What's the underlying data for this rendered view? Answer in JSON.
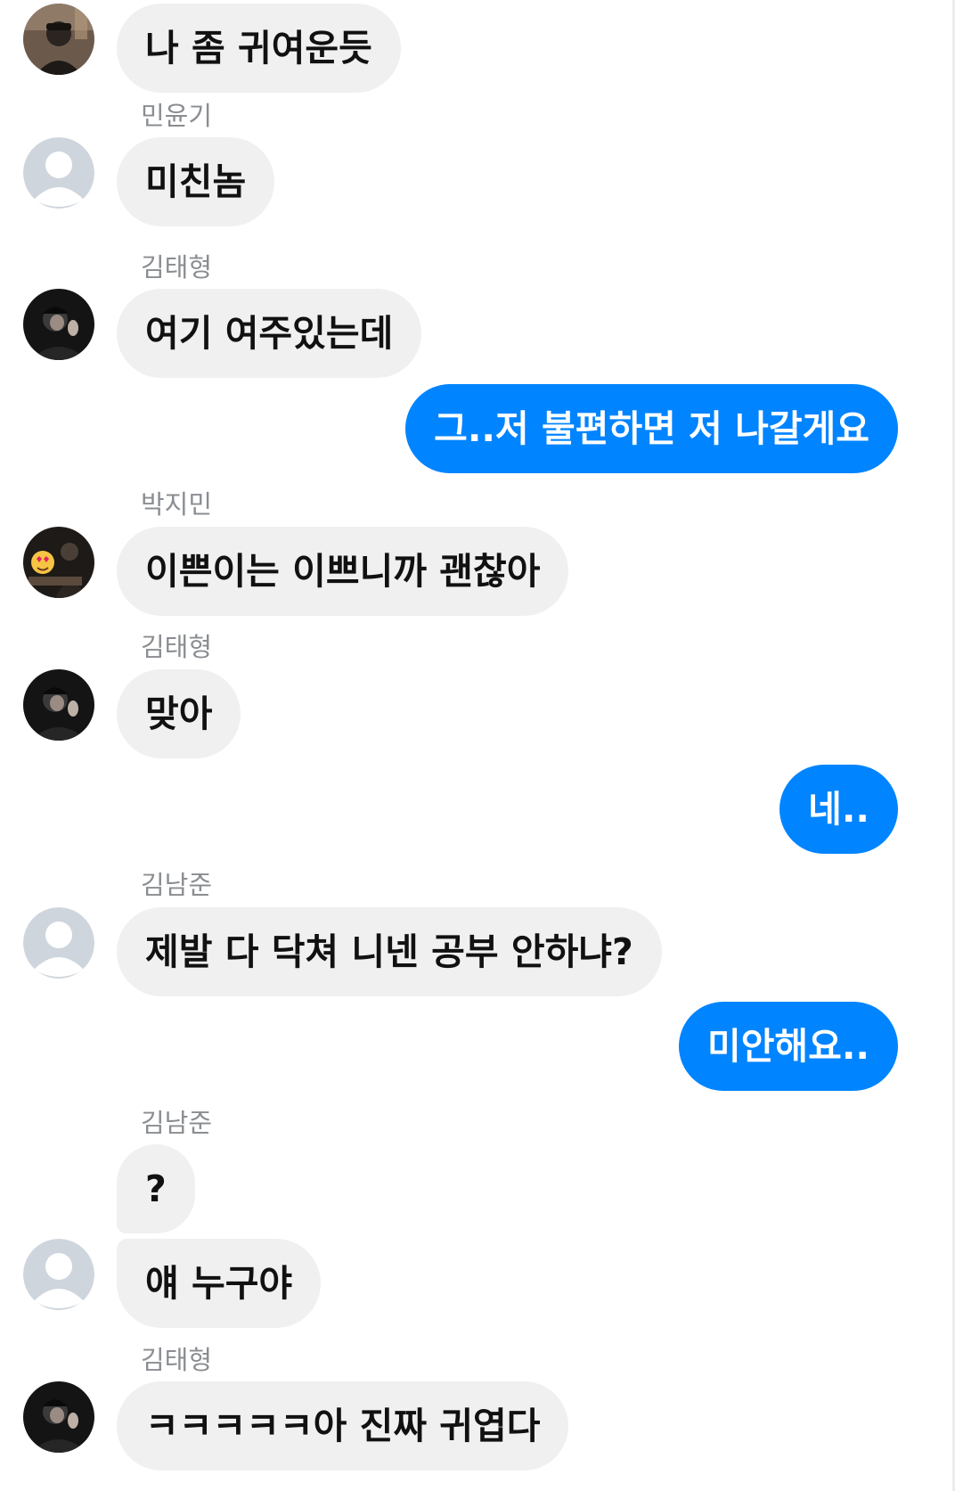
{
  "colors": {
    "incoming_bubble": "#f0f0f0",
    "outgoing_bubble": "#0084ff",
    "name_text": "#8a8d91",
    "placeholder_avatar": "#cfd5dc"
  },
  "messages": [
    {
      "text": "나 좀 귀여운듯"
    },
    {
      "sender": "민윤기",
      "text": "미친놈"
    },
    {
      "sender": "김태형",
      "text": "여기 여주있는데"
    },
    {
      "text": "그..저 불편하면 저 나갈게요"
    },
    {
      "sender": "박지민",
      "text": "이쁜이는 이쁘니까 괜찮아"
    },
    {
      "sender": "김태형",
      "text": "맞아"
    },
    {
      "text": "네.."
    },
    {
      "sender": "김남준",
      "text": "제발 다 닥쳐 니넨 공부 안하냐?"
    },
    {
      "text": "미안해요.."
    },
    {
      "sender": "김남준",
      "text": "?"
    },
    {
      "text": "얘 누구야"
    },
    {
      "sender": "김태형",
      "text": "ㅋㅋㅋㅋㅋ아 진짜 귀엽다"
    }
  ]
}
